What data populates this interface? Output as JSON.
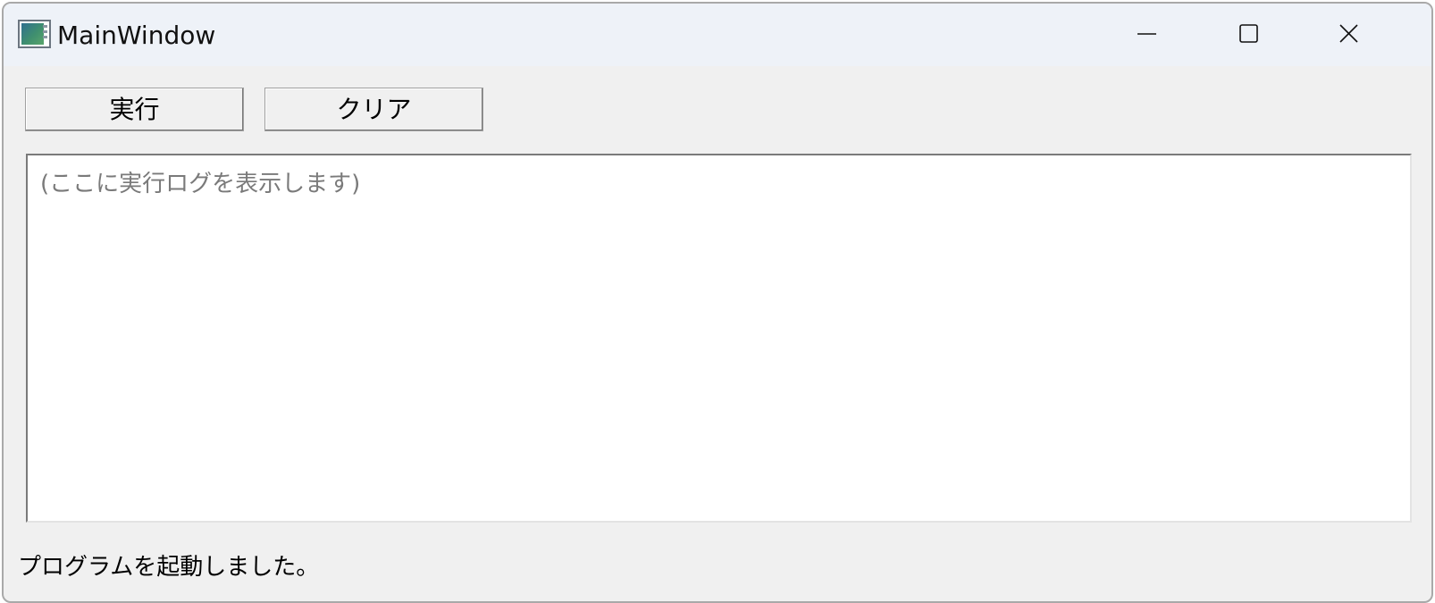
{
  "window": {
    "title": "MainWindow",
    "app_icon": "application-window-icon",
    "controls": {
      "minimize_icon": "minimize-icon",
      "maximize_icon": "maximize-icon",
      "close_icon": "close-icon"
    }
  },
  "toolbar": {
    "run_label": "実行",
    "clear_label": "クリア"
  },
  "log": {
    "placeholder": "(ここに実行ログを表示します)"
  },
  "status": {
    "text": "プログラムを起動しました。"
  },
  "colors": {
    "titlebar_bg": "#eef2f8",
    "window_bg": "#f0f0f0",
    "placeholder_text": "#7a7a7a"
  }
}
